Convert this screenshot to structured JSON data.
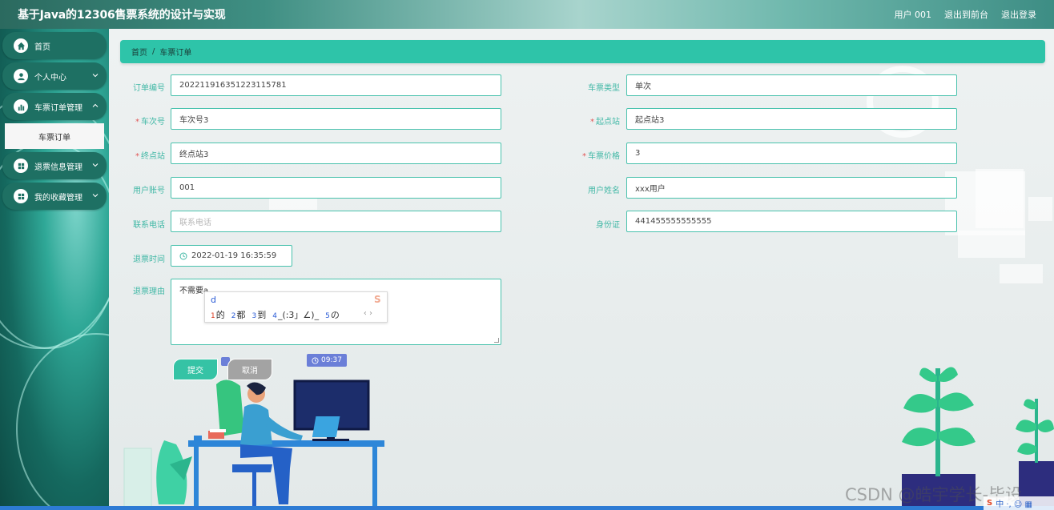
{
  "header": {
    "title": "基于Java的12306售票系统的设计与实现",
    "links": [
      "用户 001",
      "退出到前台",
      "退出登录"
    ]
  },
  "sidebar": {
    "items": [
      {
        "label": "首页",
        "icon": "home-icon"
      },
      {
        "label": "个人中心",
        "icon": "user-icon"
      },
      {
        "label": "车票订单管理",
        "icon": "chart-icon"
      },
      {
        "label": "车票订单",
        "icon": ""
      },
      {
        "label": "退票信息管理",
        "icon": "grid-icon"
      },
      {
        "label": "我的收藏管理",
        "icon": "grid-icon"
      }
    ]
  },
  "breadcrumb": {
    "home": "首页",
    "separator": "/",
    "current": "车票订单"
  },
  "form": {
    "order_no": {
      "label": "订单编号",
      "value": "2022119163512231157​81"
    },
    "ticket_type": {
      "label": "车票类型",
      "value": "单次"
    },
    "train_no": {
      "label": "车次号",
      "value": "车次号3"
    },
    "start_station": {
      "label": "起点站",
      "value": "起点站3"
    },
    "end_station": {
      "label": "终点站",
      "value": "终点站3"
    },
    "price": {
      "label": "车票价格",
      "value": "3"
    },
    "account": {
      "label": "用户账号",
      "value": "001"
    },
    "user_name": {
      "label": "用户姓名",
      "value": "xxx用户"
    },
    "phone": {
      "label": "联系电话",
      "placeholder": "联系电话"
    },
    "id_card": {
      "label": "身份证",
      "value": "441455555555555"
    },
    "refund_time": {
      "label": "退票时间",
      "value": "2022-01-19 16:35:59"
    },
    "refund_reason": {
      "label": "退票理由",
      "value": "不需要a"
    },
    "required_mark": "*"
  },
  "ime": {
    "input": "d",
    "candidates": [
      {
        "num": "1",
        "text": "的"
      },
      {
        "num": "2",
        "text": "都"
      },
      {
        "num": "3",
        "text": "到"
      },
      {
        "num": "4",
        "text": "_(:3」∠)_"
      },
      {
        "num": "5",
        "text": "の"
      }
    ],
    "arrows": "‹ ›"
  },
  "buttons": {
    "submit": "提交",
    "cancel": "取消"
  },
  "time_badge": "09:37",
  "watermark": "CSDN @皓宇学长-毕设",
  "tray": "中 ·, ☺ ▦",
  "colors": {
    "accent": "#2ec4a9",
    "sidebar": "#1e7063",
    "label": "#42b8a6",
    "required": "#e05656"
  }
}
